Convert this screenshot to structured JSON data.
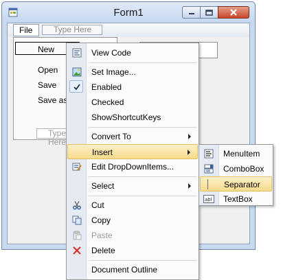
{
  "window": {
    "title": "Form1"
  },
  "menu_strip": {
    "file_label": "File",
    "type_here": "Type Here"
  },
  "file_dropdown": {
    "items": [
      "New",
      "Open",
      "Save",
      "Save as"
    ],
    "type_here": "Type Here"
  },
  "context_menu": {
    "items": [
      {
        "label": "View Code",
        "icon": "view-code-icon"
      },
      {
        "label": "Set Image...",
        "icon": "image-icon"
      },
      {
        "label": "Enabled",
        "icon": "checkmark-icon",
        "checked": true
      },
      {
        "label": "Checked"
      },
      {
        "label": "ShowShortcutKeys"
      },
      {
        "label": "Convert To",
        "submenu": true
      },
      {
        "label": "Insert",
        "submenu": true,
        "highlighted": true
      },
      {
        "label": "Edit DropDownItems...",
        "icon": "edit-items-icon"
      },
      {
        "label": "Select",
        "submenu": true
      },
      {
        "label": "Cut",
        "icon": "scissors-icon"
      },
      {
        "label": "Copy",
        "icon": "copy-icon"
      },
      {
        "label": "Paste",
        "icon": "paste-icon",
        "disabled": true
      },
      {
        "label": "Delete",
        "icon": "delete-x-icon"
      },
      {
        "label": "Document Outline"
      }
    ]
  },
  "insert_submenu": {
    "items": [
      {
        "label": "MenuItem",
        "icon": "menu-item-icon"
      },
      {
        "label": "ComboBox",
        "icon": "combobox-icon"
      },
      {
        "label": "Separator",
        "icon": "separator-icon",
        "highlighted": true
      },
      {
        "label": "TextBox",
        "icon": "textbox-icon",
        "icon_text": "abl"
      }
    ]
  },
  "colors": {
    "highlight": "#f7dc8d",
    "highlight_border": "#e3bf60",
    "title_bar": "#c9daf0",
    "close_button": "#c8452c"
  }
}
